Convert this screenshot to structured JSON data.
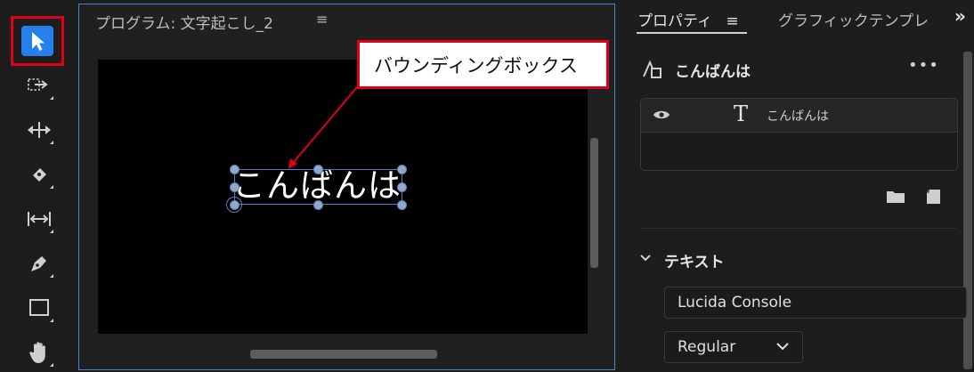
{
  "program": {
    "title": "プログラム: 文字起こし_2",
    "menu_glyph": "≡",
    "caption_text": "こんばんは"
  },
  "annotation": {
    "label": "バウンディングボックス",
    "color": "#e0001b"
  },
  "tools": [
    {
      "name": "selection-tool",
      "icon": "arrow-pointer",
      "active": true
    },
    {
      "name": "track-select-forward-tool",
      "icon": "track-select-forward"
    },
    {
      "name": "ripple-edit-tool",
      "icon": "ripple-edit"
    },
    {
      "name": "razor-tool",
      "icon": "razor"
    },
    {
      "name": "slip-tool",
      "icon": "slip"
    },
    {
      "name": "pen-tool",
      "icon": "pen"
    },
    {
      "name": "rectangle-tool",
      "icon": "rectangle"
    },
    {
      "name": "hand-tool",
      "icon": "hand"
    }
  ],
  "properties": {
    "tab_properties": "プロパティ",
    "tab_menu_glyph": "≡",
    "tab_graphics": "グラフィックテンプレ",
    "tab_overflow": "»",
    "clip_name": "こんばんは",
    "more_glyph": "•••",
    "layer": {
      "type_glyph": "T",
      "name": "こんばんは"
    },
    "section_title": "テキスト",
    "font_family": "Lucida Console",
    "font_style": "Regular"
  },
  "colors": {
    "accent": "#2680eb",
    "selection_outline": "#4a80c8",
    "panel_bg": "#1d1d1d"
  }
}
